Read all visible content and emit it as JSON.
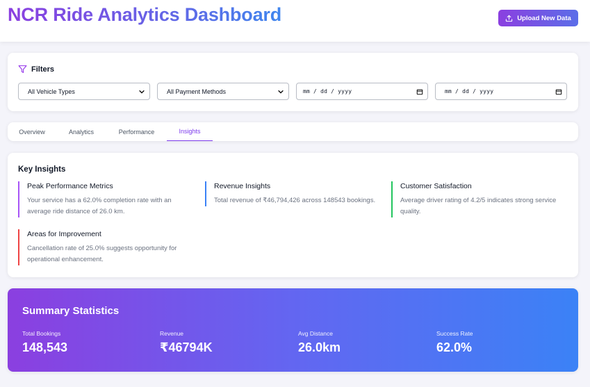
{
  "header": {
    "title": "NCR Ride Analytics Dashboard",
    "upload_label": "Upload New Data"
  },
  "filters": {
    "title": "Filters",
    "vehicle_type": "All Vehicle Types",
    "payment_method": "All Payment Methods",
    "start_date_placeholder": "mm / dd / yyyy",
    "end_date_placeholder": "mm / dd / yyyy"
  },
  "tabs": [
    {
      "label": "Overview",
      "active": false
    },
    {
      "label": "Analytics",
      "active": false
    },
    {
      "label": "Performance",
      "active": false
    },
    {
      "label": "Insights",
      "active": true
    }
  ],
  "insights": {
    "title": "Key Insights",
    "items": [
      {
        "title": "Peak Performance Metrics",
        "text": "Your service has a 62.0% completion rate with an average ride distance of 26.0 km.",
        "color": "#a855f7"
      },
      {
        "title": "Revenue Insights",
        "text": "Total revenue of ₹46,794,426 across 148543 bookings.",
        "color": "#3b82f6"
      },
      {
        "title": "Customer Satisfaction",
        "text": "Average driver rating of 4.2/5 indicates strong service quality.",
        "color": "#22c55e"
      },
      {
        "title": "Areas for Improvement",
        "text": "Cancellation rate of 25.0% suggests opportunity for operational enhancement.",
        "color": "#ef4444"
      }
    ]
  },
  "summary": {
    "title": "Summary Statistics",
    "stats": [
      {
        "label": "Total Bookings",
        "value": "148,543"
      },
      {
        "label": "Revenue",
        "value": "₹46794K"
      },
      {
        "label": "Avg Distance",
        "value": "26.0km"
      },
      {
        "label": "Success Rate",
        "value": "62.0%"
      }
    ]
  },
  "colors": {
    "accent_purple": "#7c3aed",
    "accent_blue": "#3b82f6"
  }
}
